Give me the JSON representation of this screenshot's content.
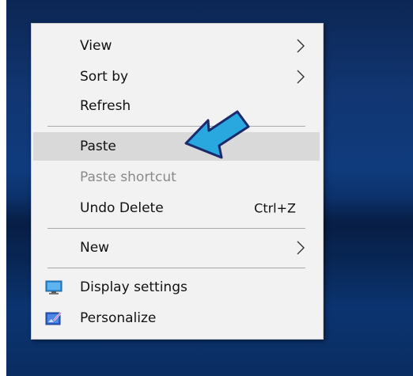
{
  "context_menu": {
    "items": [
      {
        "label": "View",
        "submenu": true
      },
      {
        "label": "Sort by",
        "submenu": true
      },
      {
        "label": "Refresh"
      },
      {
        "label": "Paste",
        "highlighted": true
      },
      {
        "label": "Paste shortcut",
        "disabled": true
      },
      {
        "label": "Undo Delete",
        "shortcut": "Ctrl+Z"
      },
      {
        "label": "New",
        "submenu": true
      },
      {
        "label": "Display settings",
        "icon": "display-settings-icon"
      },
      {
        "label": "Personalize",
        "icon": "personalize-icon"
      }
    ]
  },
  "annotation": {
    "icon": "pointer-arrow-icon",
    "color": "#29a8e0",
    "outline_color": "#1a2a6c"
  },
  "colors": {
    "menu_background": "#f2f2f2",
    "highlight": "#d9d9d9",
    "disabled_text": "#8a8a8a",
    "desktop": "#0f3b7d"
  }
}
